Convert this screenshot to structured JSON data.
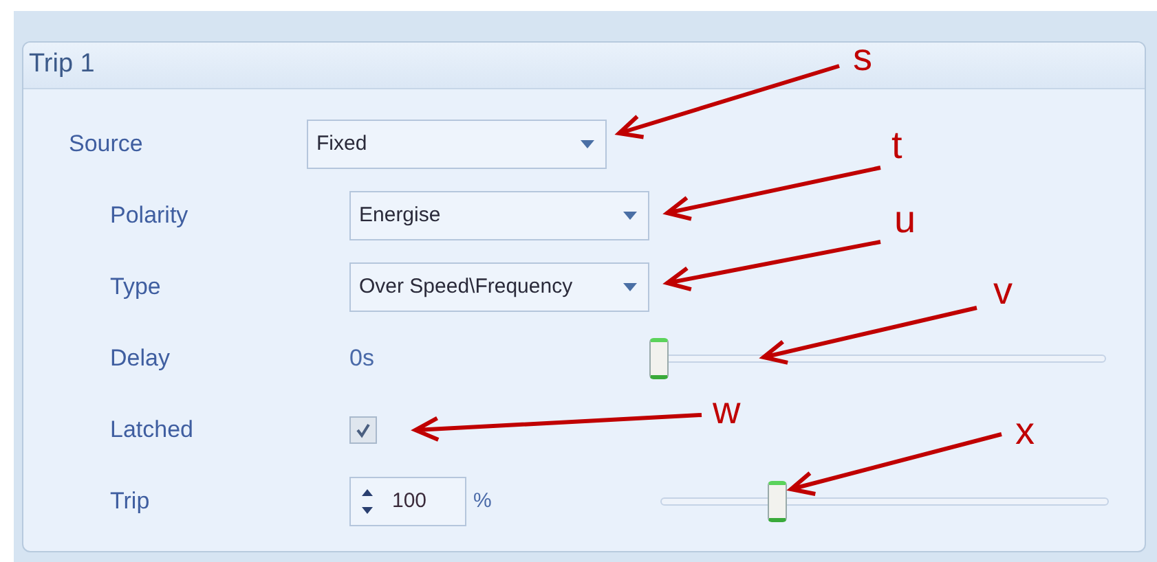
{
  "panel": {
    "title": "Trip 1"
  },
  "rows": [
    {
      "kind": "dropdown",
      "label": "Source",
      "value": "Fixed"
    },
    {
      "kind": "dropdown",
      "label": "Polarity",
      "value": "Energise"
    },
    {
      "kind": "dropdown",
      "label": "Type",
      "value": "Over Speed\\Frequency"
    },
    {
      "kind": "slider",
      "label": "Delay",
      "value": "0s",
      "level": 0
    },
    {
      "kind": "checkbox",
      "label": "Latched",
      "checked": true
    },
    {
      "kind": "spinner",
      "label": "Trip",
      "value": "100",
      "unit": "%",
      "level": 0.25
    }
  ],
  "annotations": [
    {
      "label": "s"
    },
    {
      "label": "t"
    },
    {
      "label": "u"
    },
    {
      "label": "v"
    },
    {
      "label": "w"
    },
    {
      "label": "x"
    }
  ]
}
